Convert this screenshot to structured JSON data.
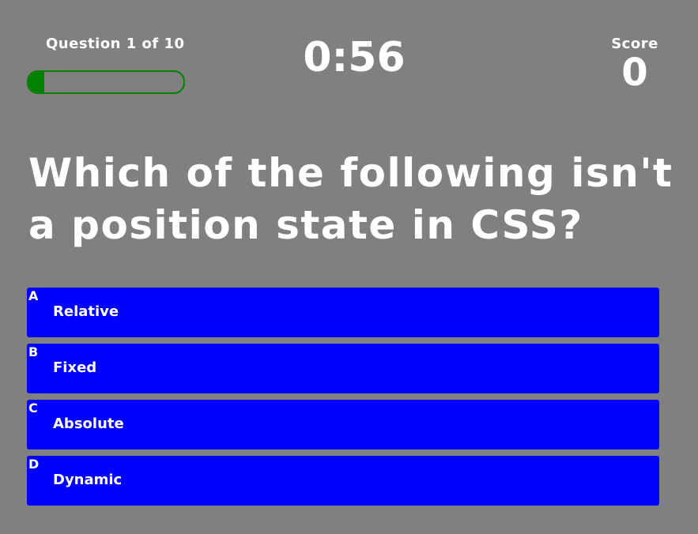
{
  "header": {
    "question_counter": "Question 1 of 10",
    "timer": "0:56",
    "score_label": "Score",
    "score_value": "0",
    "progress_fraction": 0.1
  },
  "question": {
    "text": "Which of the following isn't a position state in CSS?"
  },
  "answers": [
    {
      "letter": "A",
      "label": "Relative"
    },
    {
      "letter": "B",
      "label": "Fixed"
    },
    {
      "letter": "C",
      "label": "Absolute"
    },
    {
      "letter": "D",
      "label": "Dynamic"
    }
  ],
  "colors": {
    "background": "#808080",
    "progress": "#008000",
    "answer_button": "#0000ff",
    "text": "#ffffff"
  }
}
